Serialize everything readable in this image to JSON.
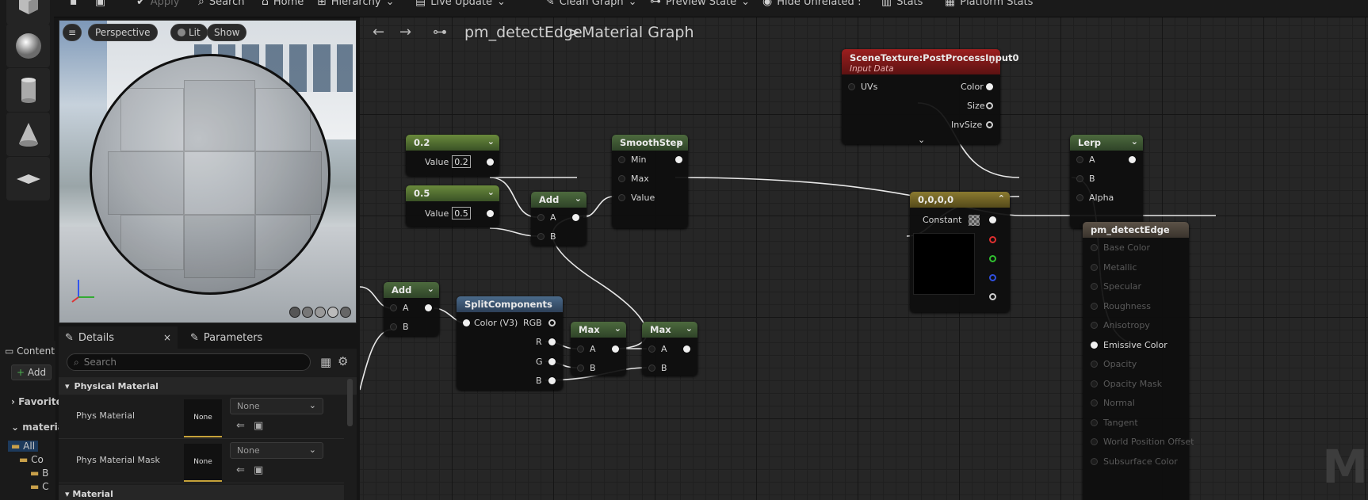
{
  "toolbar": {
    "apply": "Apply",
    "search": "Search",
    "home": "Home",
    "hierarchy": "Hierarchy",
    "live_update": "Live Update",
    "clean_graph": "Clean Graph",
    "preview_state": "Preview State",
    "hide_unrelated": "Hide Unrelated",
    "stats": "Stats",
    "platform_stats": "Platform Stats"
  },
  "viewport": {
    "perspective": "Perspective",
    "lit": "Lit",
    "show": "Show"
  },
  "details": {
    "tab_details": "Details",
    "tab_parameters": "Parameters",
    "search_placeholder": "Search",
    "section_physical": "Physical Material",
    "section_material": "Material",
    "props": [
      {
        "label": "Phys Material",
        "thumb": "None",
        "value": "None"
      },
      {
        "label": "Phys Material Mask",
        "thumb": "None",
        "value": "None"
      }
    ]
  },
  "content_browser": {
    "tab": "Content",
    "add": "Add",
    "favorites": "Favorites",
    "materials": "materials",
    "all": "All",
    "co": "Co",
    "b": "B",
    "c": "C"
  },
  "graph": {
    "breadcrumb_asset": "pm_detectEdge",
    "breadcrumb_sep": ">",
    "breadcrumb_graph": "Material Graph",
    "watermark": "M",
    "nodes": {
      "c02": {
        "title": "0.2",
        "value_label": "Value",
        "value": "0.2"
      },
      "c05": {
        "title": "0.5",
        "value_label": "Value",
        "value": "0.5"
      },
      "add1": {
        "title": "Add",
        "a": "A",
        "b": "B"
      },
      "smooth": {
        "title": "SmoothStep",
        "min": "Min",
        "max": "Max",
        "value": "Value"
      },
      "scene": {
        "title": "SceneTexture:PostProcessInput0",
        "subtitle": "Input Data",
        "uvs": "UVs",
        "color": "Color",
        "size": "Size",
        "invsize": "InvSize"
      },
      "lerp": {
        "title": "Lerp",
        "a": "A",
        "b": "B",
        "alpha": "Alpha"
      },
      "const3": {
        "title": "0,0,0,0",
        "constant": "Constant"
      },
      "add2": {
        "title": "Add",
        "a": "A",
        "b": "B"
      },
      "split": {
        "title": "SplitComponents",
        "input": "Color (V3)",
        "rgb": "RGB",
        "r": "R",
        "g": "G",
        "b": "B"
      },
      "max1": {
        "title": "Max",
        "a": "A",
        "b": "B"
      },
      "max2": {
        "title": "Max",
        "a": "A",
        "b": "B"
      },
      "result": {
        "title": "pm_detectEdge",
        "pins": [
          "Base Color",
          "Metallic",
          "Specular",
          "Roughness",
          "Anisotropy",
          "Emissive Color",
          "Opacity",
          "Opacity Mask",
          "Normal",
          "Tangent",
          "World Position Offset",
          "Subsurface Color"
        ],
        "active_pin": "Emissive Color"
      }
    }
  }
}
